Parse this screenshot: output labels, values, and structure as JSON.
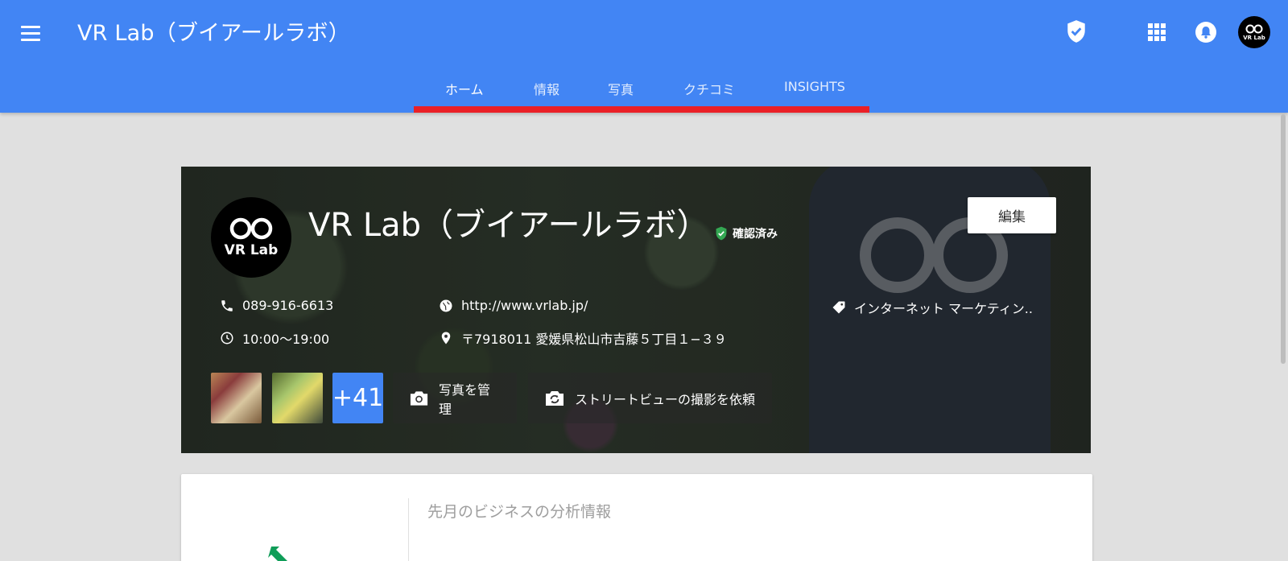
{
  "app": {
    "title": "VR Lab（ブイアールラボ）"
  },
  "tabs": [
    {
      "label": "ホーム",
      "active": true
    },
    {
      "label": "情報",
      "active": false
    },
    {
      "label": "写真",
      "active": false
    },
    {
      "label": "クチコミ",
      "active": false
    },
    {
      "label": "INSIGHTS",
      "active": false
    }
  ],
  "avatar": {
    "text": "VR Lab"
  },
  "business": {
    "name": "VR Lab（ブイアールラボ）",
    "verified_label": "確認済み",
    "edit_label": "編集",
    "phone": "089-916-6613",
    "hours": "10:00〜19:00",
    "website": "http://www.vrlab.jp/",
    "address": "〒7918011 愛媛県松山市吉藤５丁目１−３９",
    "category": "インターネット マーケティン..",
    "more_photos": "+41",
    "manage_photos_label": "写真を管理",
    "street_view_label": "ストリートビューの撮影を依頼"
  },
  "insights": {
    "heading": "先月のビジネスの分析情報"
  },
  "colors": {
    "appbar": "#4285f4",
    "tab_indicator": "#ea2027",
    "verified": "#34a853"
  },
  "icons": [
    "menu-icon",
    "shield-check-icon",
    "apps-icon",
    "bell-icon",
    "phone-icon",
    "clock-icon",
    "globe-icon",
    "location-pin-icon",
    "tag-icon",
    "camera-icon",
    "camera-rotate-icon",
    "trending-arrow-icon"
  ]
}
